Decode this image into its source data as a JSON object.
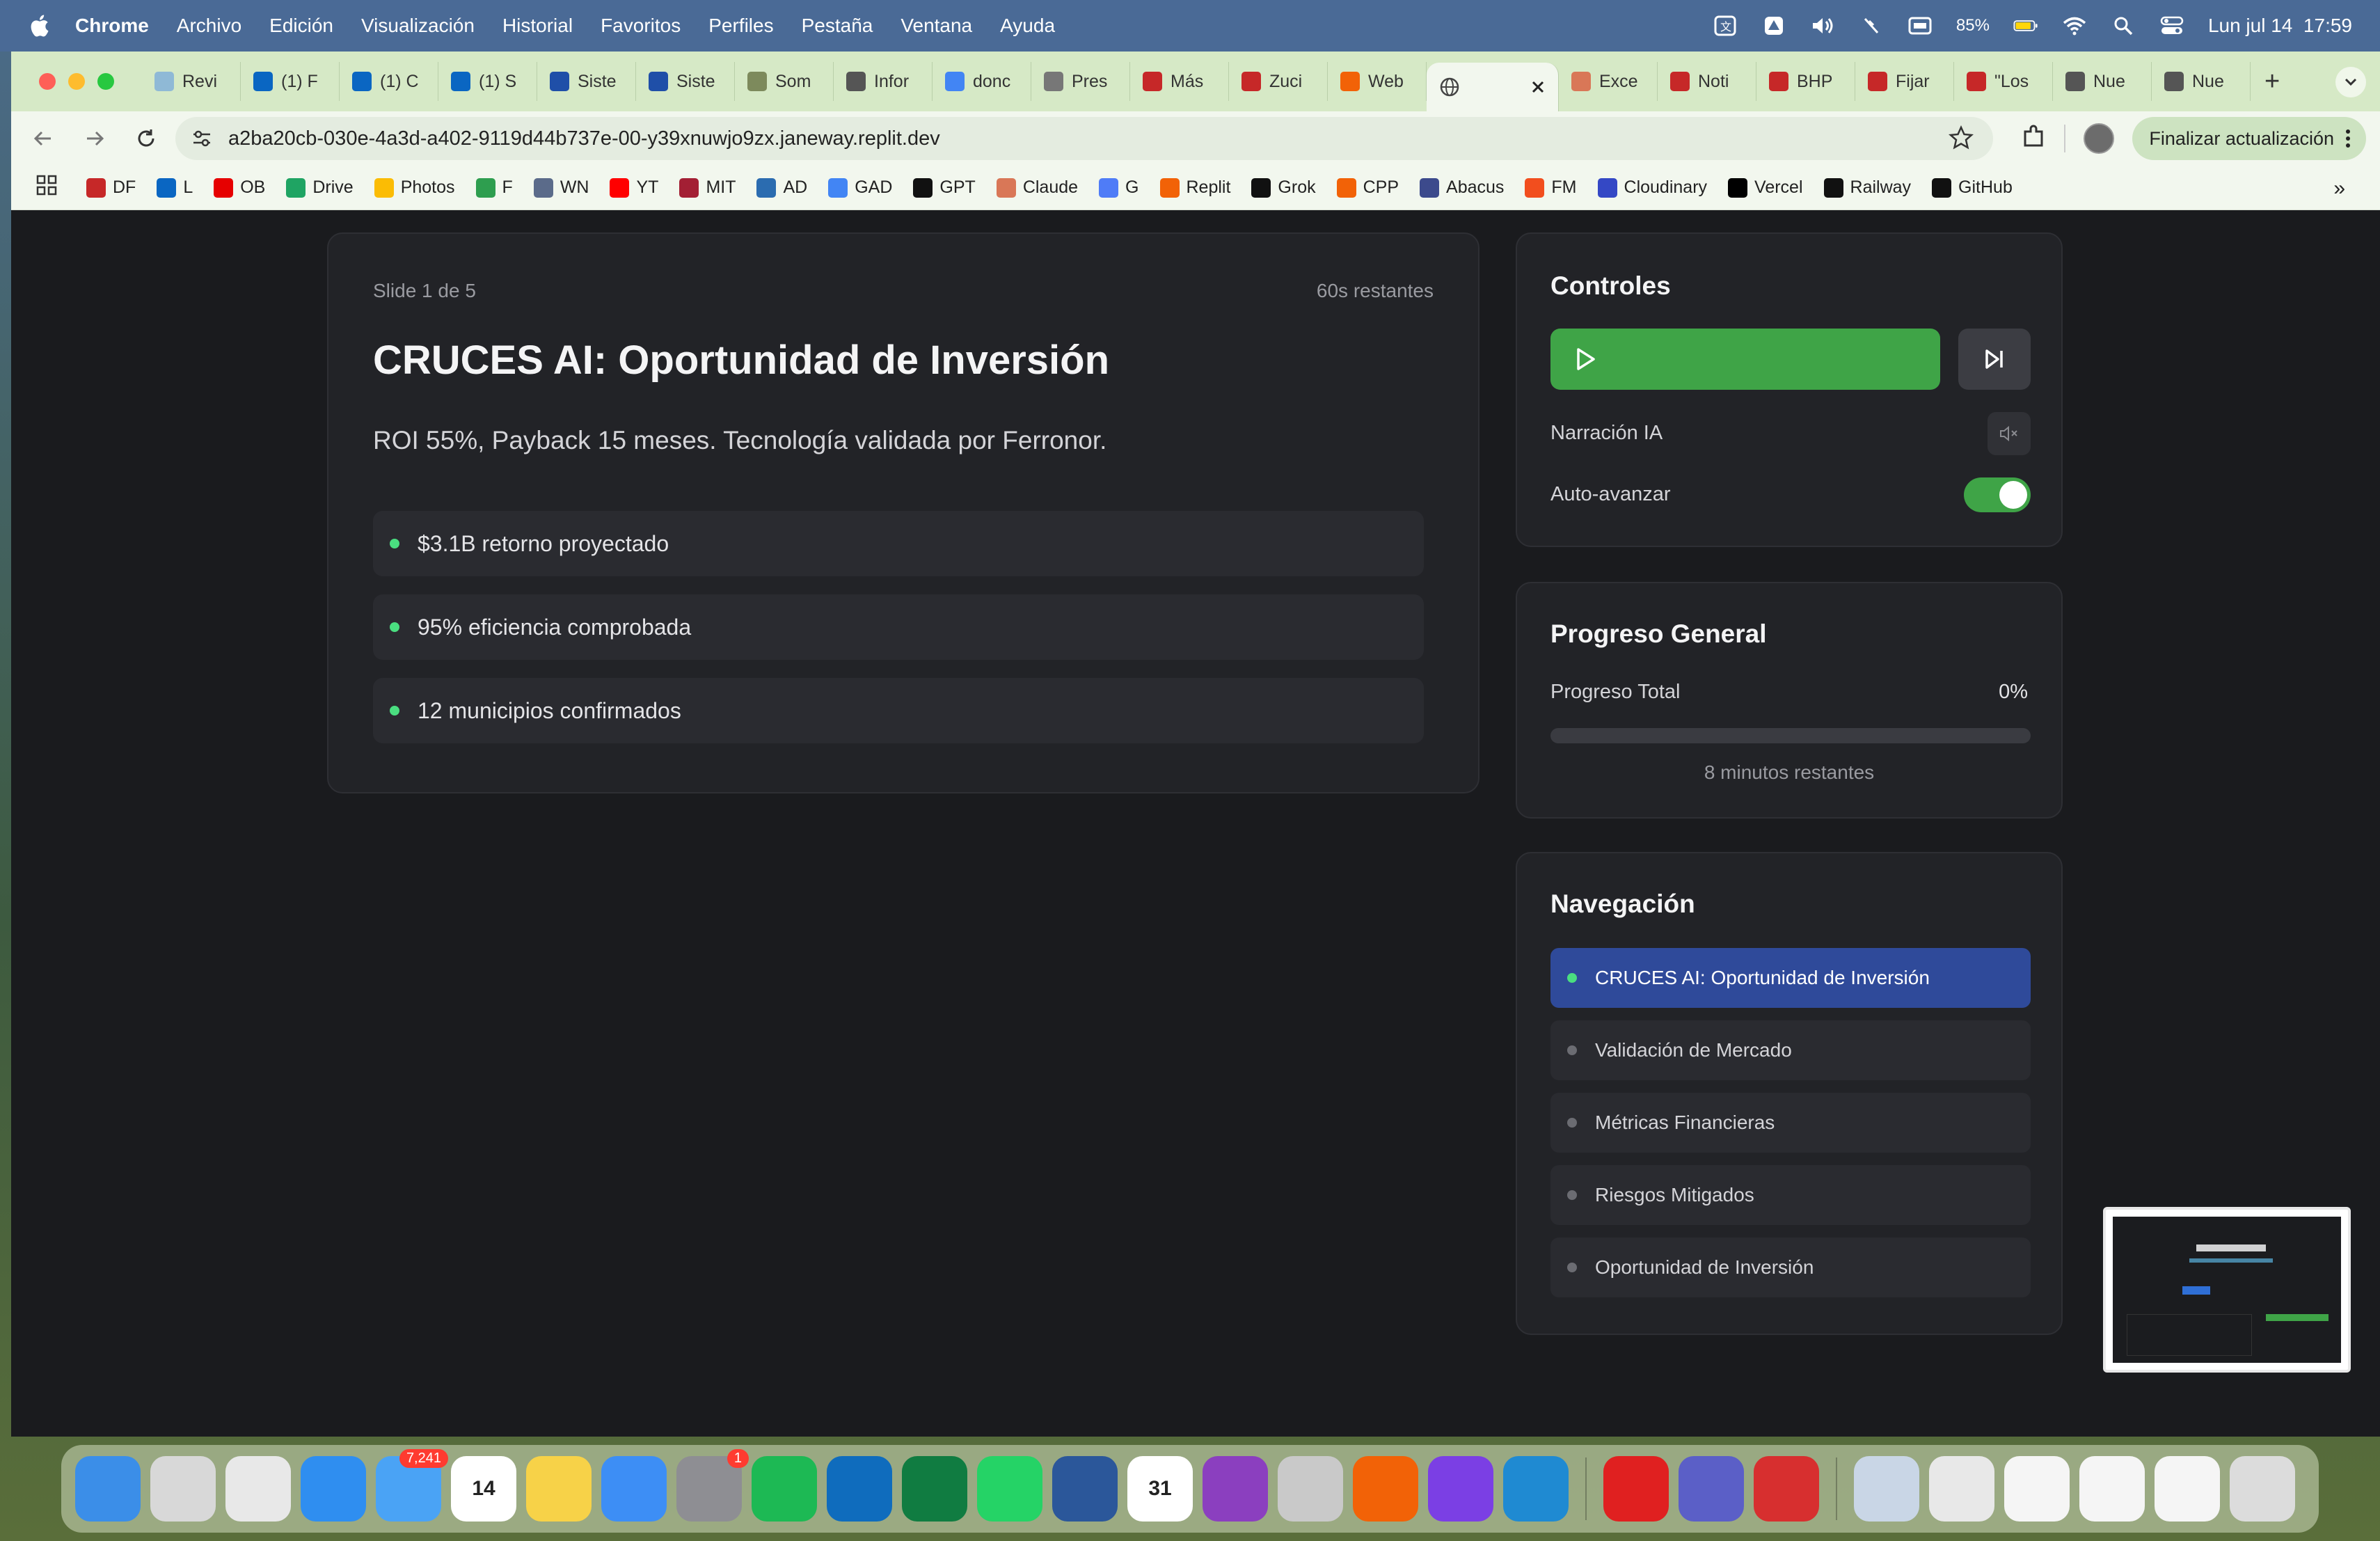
{
  "menubar": {
    "app": "Chrome",
    "items": [
      "Archivo",
      "Edición",
      "Visualización",
      "Historial",
      "Favoritos",
      "Perfiles",
      "Pestaña",
      "Ventana",
      "Ayuda"
    ],
    "battery": "85%",
    "datetime": "Lun jul 14  17:59"
  },
  "tabs": [
    {
      "label": "Revi",
      "icon": "wave-icon",
      "color": "#8fb9d6"
    },
    {
      "label": "(1) F",
      "icon": "linkedin-icon",
      "color": "#0a66c2"
    },
    {
      "label": "(1) C",
      "icon": "linkedin-icon",
      "color": "#0a66c2"
    },
    {
      "label": "(1) S",
      "icon": "linkedin-icon",
      "color": "#0a66c2"
    },
    {
      "label": "Siste",
      "icon": "flag-icon",
      "color": "#1f4fa8"
    },
    {
      "label": "Siste",
      "icon": "flag-icon",
      "color": "#1f4fa8"
    },
    {
      "label": "Som",
      "icon": "cap-icon",
      "color": "#7d8a5c"
    },
    {
      "label": "Infor",
      "icon": "globe-icon",
      "color": "#555555"
    },
    {
      "label": "donc",
      "icon": "google-icon",
      "color": "#4285f4"
    },
    {
      "label": "Pres",
      "icon": "c-icon",
      "color": "#777777"
    },
    {
      "label": "Más",
      "icon": "df-icon",
      "color": "#c62828"
    },
    {
      "label": "Zuci",
      "icon": "df-icon",
      "color": "#c62828"
    },
    {
      "label": "Web",
      "icon": "replit-icon",
      "color": "#f26207"
    }
  ],
  "active_tab": {
    "icon": "globe-icon"
  },
  "tabs_after": [
    {
      "label": "Exce",
      "icon": "claude-icon",
      "color": "#d97757"
    },
    {
      "label": "Noti",
      "icon": "df-icon",
      "color": "#c62828"
    },
    {
      "label": "BHP",
      "icon": "df-icon",
      "color": "#c62828"
    },
    {
      "label": "Fijar",
      "icon": "df-icon",
      "color": "#c62828"
    },
    {
      "label": "\"Los",
      "icon": "df-icon",
      "color": "#c62828"
    },
    {
      "label": "Nue",
      "icon": "chrome-icon",
      "color": "#555555"
    },
    {
      "label": "Nue",
      "icon": "chrome-icon",
      "color": "#555555"
    }
  ],
  "toolbar": {
    "url": "a2ba20cb-030e-4a3d-a402-9119d44b737e-00-y39xnuwjo9zx.janeway.replit.dev",
    "update_label": "Finalizar actualización"
  },
  "bookmarks": [
    {
      "label": "DF",
      "icon": "df-icon",
      "color": "#c62828"
    },
    {
      "label": "L",
      "icon": "linkedin-icon",
      "color": "#0a66c2"
    },
    {
      "label": "OB",
      "icon": "santander-icon",
      "color": "#e60000"
    },
    {
      "label": "Drive",
      "icon": "drive-icon",
      "color": "#1fa463"
    },
    {
      "label": "Photos",
      "icon": "photos-icon",
      "color": "#fbbc04"
    },
    {
      "label": "F",
      "icon": "f-icon",
      "color": "#2e9e4f"
    },
    {
      "label": "WN",
      "icon": "wn-icon",
      "color": "#5b6b8a"
    },
    {
      "label": "YT",
      "icon": "youtube-icon",
      "color": "#ff0000"
    },
    {
      "label": "MIT",
      "icon": "mit-icon",
      "color": "#a31f34"
    },
    {
      "label": "AD",
      "icon": "ad-icon",
      "color": "#2b6cb0"
    },
    {
      "label": "GAD",
      "icon": "google-icon",
      "color": "#4285f4"
    },
    {
      "label": "GPT",
      "icon": "openai-icon",
      "color": "#111111"
    },
    {
      "label": "Claude",
      "icon": "claude-icon",
      "color": "#d97757"
    },
    {
      "label": "G",
      "icon": "gemini-icon",
      "color": "#4f7cf7"
    },
    {
      "label": "Replit",
      "icon": "replit-icon",
      "color": "#f26207"
    },
    {
      "label": "Grok",
      "icon": "grok-icon",
      "color": "#111111"
    },
    {
      "label": "CPP",
      "icon": "cpp-icon",
      "color": "#f26207"
    },
    {
      "label": "Abacus",
      "icon": "abacus-icon",
      "color": "#3c4a8c"
    },
    {
      "label": "FM",
      "icon": "figma-icon",
      "color": "#f24e1e"
    },
    {
      "label": "Cloudinary",
      "icon": "cloudinary-icon",
      "color": "#3448c5"
    },
    {
      "label": "Vercel",
      "icon": "vercel-icon",
      "color": "#000000"
    },
    {
      "label": "Railway",
      "icon": "railway-icon",
      "color": "#111111"
    },
    {
      "label": "GitHub",
      "icon": "github-icon",
      "color": "#111111"
    }
  ],
  "slide": {
    "counter": "Slide 1 de 5",
    "timer": "60s restantes",
    "title": "CRUCES AI: Oportunidad de Inversión",
    "subtitle": "ROI 55%, Payback 15 meses. Tecnología validada por Ferronor.",
    "bullets": [
      "$3.1B retorno proyectado",
      "95% eficiencia comprobada",
      "12 municipios confirmados"
    ]
  },
  "controls": {
    "title": "Controles",
    "narration_label": "Narración IA",
    "autoadvance_label": "Auto-avanzar",
    "autoadvance_on": true,
    "accent": "#3fa447"
  },
  "progress": {
    "title": "Progreso General",
    "label": "Progreso Total",
    "value_text": "0%",
    "value": 0,
    "remaining": "8 minutos restantes"
  },
  "navigation": {
    "title": "Navegación",
    "items": [
      "CRUCES AI: Oportunidad de Inversión",
      "Validación de Mercado",
      "Métricas Financieras",
      "Riesgos Mitigados",
      "Oportunidad de Inversión"
    ],
    "active_index": 0
  },
  "dock": [
    {
      "icon": "finder-icon",
      "color": "#3b8ee8"
    },
    {
      "icon": "launchpad-icon",
      "color": "#d8d8d8"
    },
    {
      "icon": "chrome-icon",
      "color": "#e8e8e8"
    },
    {
      "icon": "safari-icon",
      "color": "#2f8ef0"
    },
    {
      "icon": "mail-icon",
      "color": "#4aa3f5",
      "badge": "7,241"
    },
    {
      "icon": "calendar-icon",
      "color": "#ffffff",
      "text": "14"
    },
    {
      "icon": "notes-icon",
      "color": "#f7d248"
    },
    {
      "icon": "keynote-icon",
      "color": "#3d8ef5"
    },
    {
      "icon": "settings-icon",
      "color": "#8e8e93",
      "badge": "1"
    },
    {
      "icon": "spotify-icon",
      "color": "#1db954"
    },
    {
      "icon": "outlook-icon",
      "color": "#0f6cbd"
    },
    {
      "icon": "excel-icon",
      "color": "#107c41"
    },
    {
      "icon": "whatsapp-icon",
      "color": "#25d366"
    },
    {
      "icon": "word-icon",
      "color": "#2b579a"
    },
    {
      "icon": "calendar31-icon",
      "color": "#ffffff",
      "text": "31"
    },
    {
      "icon": "screen-record-icon",
      "color": "#8b3fbf"
    },
    {
      "icon": "iphone-mirror-icon",
      "color": "#c9c9c9"
    },
    {
      "icon": "replit-icon",
      "color": "#f26207"
    },
    {
      "icon": "github-desktop-icon",
      "color": "#7b3fe4"
    },
    {
      "icon": "vscode-icon",
      "color": "#1f8ad2"
    },
    {
      "sep": true
    },
    {
      "icon": "acrobat-icon",
      "color": "#e02020"
    },
    {
      "icon": "teams-icon",
      "color": "#5b5fc7"
    },
    {
      "icon": "photo-booth-icon",
      "color": "#d72f2f"
    },
    {
      "sep": true
    },
    {
      "icon": "downloads-icon",
      "color": "#c9d6e6"
    },
    {
      "icon": "window-thumb-icon",
      "color": "#e8e8e8"
    },
    {
      "icon": "window-thumb-icon",
      "color": "#f5f5f5"
    },
    {
      "icon": "window-thumb-icon",
      "color": "#f5f5f5"
    },
    {
      "icon": "window-thumb-icon",
      "color": "#f5f5f5"
    },
    {
      "icon": "trash-icon",
      "color": "#dcdcdc"
    }
  ]
}
